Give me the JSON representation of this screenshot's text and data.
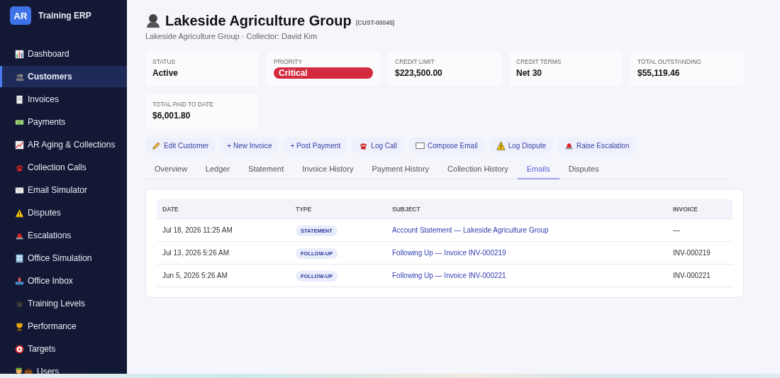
{
  "sidebar": {
    "logo": "AR",
    "app_name": "Training ERP",
    "items": [
      {
        "label": "Dashboard",
        "selected": false
      },
      {
        "label": "Customers",
        "selected": true
      },
      {
        "label": "Invoices",
        "selected": false
      },
      {
        "label": "Payments",
        "selected": false
      },
      {
        "label": "AR Aging & Collections",
        "selected": false
      },
      {
        "label": "Collection Calls",
        "selected": false
      },
      {
        "label": "Email Simulator",
        "selected": false
      },
      {
        "label": "Disputes",
        "selected": false
      },
      {
        "label": "Escalations",
        "selected": false
      },
      {
        "label": "Office Simulation",
        "selected": false
      },
      {
        "label": "Office Inbox",
        "selected": false
      },
      {
        "label": "Training Levels",
        "selected": false
      },
      {
        "label": "Performance",
        "selected": false
      },
      {
        "label": "Targets",
        "selected": false
      },
      {
        "label": "Users",
        "selected": false
      }
    ]
  },
  "header": {
    "title": "Lakeside Agriculture Group",
    "code": "(CUST-00045)",
    "subtitle": "Lakeside Agriculture Group · Collector: David Kim"
  },
  "stats": [
    {
      "label": "STATUS",
      "value": "Active",
      "kind": "text"
    },
    {
      "label": "PRIORITY",
      "value": "Critical",
      "kind": "badge",
      "color": "#d42a3f"
    },
    {
      "label": "CREDIT LIMIT",
      "value": "$223,500.00",
      "kind": "text"
    },
    {
      "label": "CREDIT TERMS",
      "value": "Net 30",
      "kind": "text"
    },
    {
      "label": "TOTAL OUTSTANDING",
      "value": "$55,119.46",
      "kind": "text"
    },
    {
      "label": "TOTAL PAID TO DATE",
      "value": "$6,001.80",
      "kind": "text"
    }
  ],
  "actions": [
    {
      "label": "Edit Customer",
      "kind": "edit"
    },
    {
      "label": "+ New Invoice",
      "kind": "plain"
    },
    {
      "label": "+ Post Payment",
      "kind": "plain"
    },
    {
      "label": "Log Call",
      "kind": "phone"
    },
    {
      "label": "Compose Email",
      "kind": "email"
    },
    {
      "label": "Log Dispute",
      "kind": "warning"
    },
    {
      "label": "Raise Escalation",
      "kind": "siren"
    }
  ],
  "tabs": [
    {
      "label": "Overview",
      "selected": false
    },
    {
      "label": "Ledger",
      "selected": false
    },
    {
      "label": "Statement",
      "selected": false
    },
    {
      "label": "Invoice History",
      "selected": false
    },
    {
      "label": "Payment History",
      "selected": false
    },
    {
      "label": "Collection History",
      "selected": false
    },
    {
      "label": "Emails",
      "selected": true
    },
    {
      "label": "Disputes",
      "selected": false
    }
  ],
  "table": {
    "columns": [
      "DATE",
      "TYPE",
      "SUBJECT",
      "INVOICE"
    ],
    "rows": [
      {
        "date": "Jul 18, 2026 11:25 AM",
        "type": "STATEMENT",
        "subject": "Account Statement — Lakeside Agriculture Group",
        "invoice": "—"
      },
      {
        "date": "Jul 13, 2026 5:26 AM",
        "type": "FOLLOW-UP",
        "subject": "Following Up — Invoice INV-000219",
        "invoice": "INV-000219"
      },
      {
        "date": "Jun 5, 2026 5:26 AM",
        "type": "FOLLOW-UP",
        "subject": "Following Up — Invoice INV-000221",
        "invoice": "INV-000221"
      }
    ]
  }
}
